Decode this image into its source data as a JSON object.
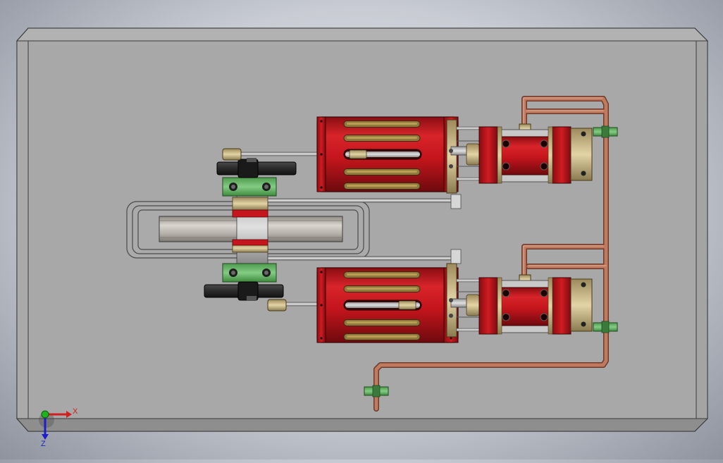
{
  "colors": {
    "background_center": "#eceef3",
    "background_edge": "#8e939e",
    "base_plate": "#a8a8a8",
    "base_plate_bevel": "#b4b4b4",
    "cylinder_red": "#c8141c",
    "cylinder_red_dark": "#7e0a10",
    "brass": "#c9b88a",
    "pipe_copper": "#b8735a",
    "pipe_outline": "#6e3a2a",
    "bearing_green": "#6fbd6f",
    "handwheel_black": "#2a2a2a",
    "flywheel_steel": "#b6b2ac",
    "axis_x": "#d21e1e",
    "axis_y": "#1eb41e",
    "axis_z": "#1e1ec8"
  },
  "axis_triad": {
    "x_label": "X",
    "z_label": "Z"
  }
}
